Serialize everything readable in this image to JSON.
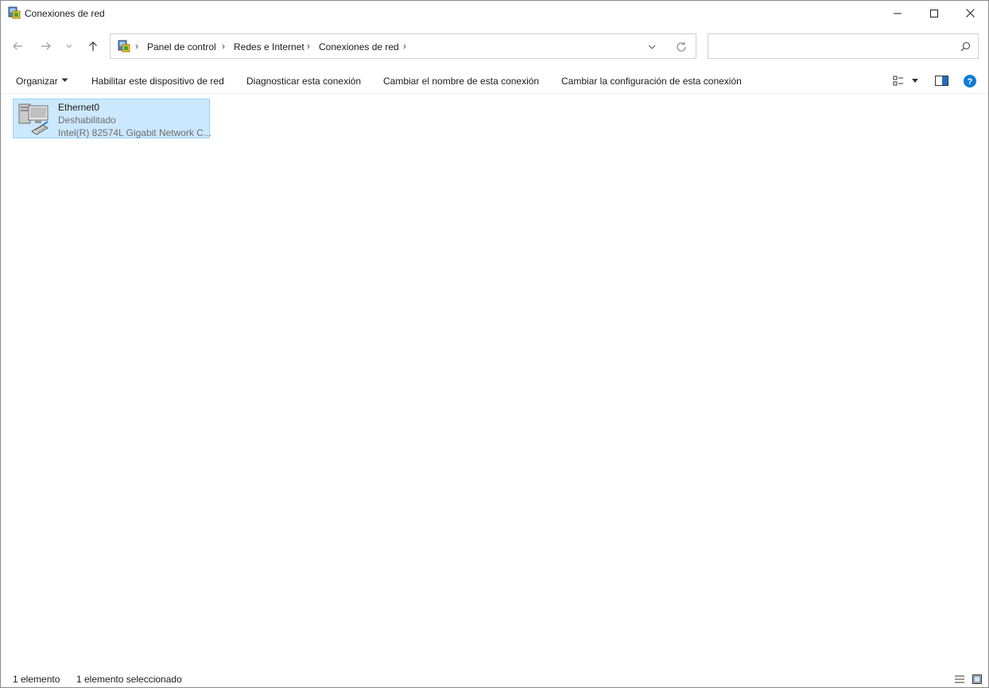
{
  "window": {
    "title": "Conexiones de red"
  },
  "address": {
    "breadcrumbs": [
      "Panel de control",
      "Redes e Internet",
      "Conexiones de red"
    ],
    "search_placeholder": ""
  },
  "toolbar": {
    "organize_label": "Organizar",
    "commands": [
      "Habilitar este dispositivo de red",
      "Diagnosticar esta conexión",
      "Cambiar el nombre de esta conexión",
      "Cambiar la configuración de esta conexión"
    ]
  },
  "items": [
    {
      "name": "Ethernet0",
      "status": "Deshabilitado",
      "device": "Intel(R) 82574L Gigabit Network C...",
      "selected": true
    }
  ],
  "statusbar": {
    "count": "1 elemento",
    "selection": "1 elemento seleccionado"
  },
  "colors": {
    "selection_bg": "#cce8ff",
    "selection_border": "#99d1ff",
    "help_blue": "#0078d4"
  }
}
